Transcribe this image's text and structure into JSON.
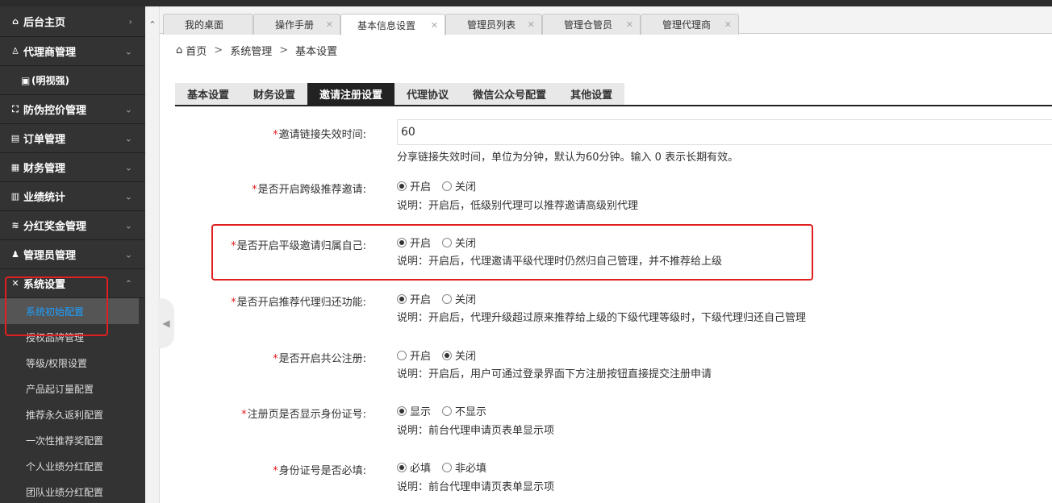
{
  "sidebar": {
    "home": {
      "label": "后台主页",
      "icon": "home-icon"
    },
    "agent_mgmt": {
      "label": "代理商管理",
      "icon": "user-icon"
    },
    "agent_sub": {
      "label": "(明视强)",
      "icon": "id-card-icon"
    },
    "anti_fake": {
      "label": "防伪控价管理",
      "icon": "scan-icon"
    },
    "orders": {
      "label": "订单管理",
      "icon": "document-icon"
    },
    "finance": {
      "label": "财务管理",
      "icon": "ledger-icon"
    },
    "stats": {
      "label": "业绩统计",
      "icon": "bar-chart-icon"
    },
    "bonus": {
      "label": "分红奖金管理",
      "icon": "database-icon"
    },
    "admins": {
      "label": "管理员管理",
      "icon": "user-gear-icon"
    },
    "system": {
      "label": "系统设置",
      "icon": "tools-icon"
    },
    "system_items": [
      {
        "label": "系统初始配置"
      },
      {
        "label": "授权品牌管理"
      },
      {
        "label": "等级/权限设置"
      },
      {
        "label": "产品起订量配置"
      },
      {
        "label": "推荐永久返利配置"
      },
      {
        "label": "一次性推荐奖配置"
      },
      {
        "label": "个人业绩分红配置"
      },
      {
        "label": "团队业绩分红配置"
      }
    ]
  },
  "tabs": [
    {
      "label": "我的桌面"
    },
    {
      "label": "操作手册"
    },
    {
      "label": "基本信息设置"
    },
    {
      "label": "管理员列表"
    },
    {
      "label": "管理仓管员"
    },
    {
      "label": "管理代理商"
    }
  ],
  "breadcrumb": {
    "home": "首页",
    "sep": ">",
    "level1": "系统管理",
    "level2": "基本设置"
  },
  "settings_tabs": [
    {
      "label": "基本设置"
    },
    {
      "label": "财务设置"
    },
    {
      "label": "邀请注册设置"
    },
    {
      "label": "代理协议"
    },
    {
      "label": "微信公众号配置"
    },
    {
      "label": "其他设置"
    }
  ],
  "form": {
    "req_mark": "*",
    "invite_expire": {
      "label": "邀请链接失效时间:",
      "value": "60",
      "hint": "分享链接失效时间，单位为分钟，默认为60分钟。输入 0 表示长期有效。"
    },
    "cross_level": {
      "label": "是否开启跨级推荐邀请:",
      "opt1": "开启",
      "opt2": "关闭",
      "selected": "开启",
      "hint": "说明：开启后，低级别代理可以推荐邀请高级别代理"
    },
    "same_level": {
      "label": "是否开启平级邀请归属自己:",
      "opt1": "开启",
      "opt2": "关闭",
      "selected": "开启",
      "hint": "说明：开启后，代理邀请平级代理时仍然归自己管理，并不推荐给上级"
    },
    "return_agent": {
      "label": "是否开启推荐代理归还功能:",
      "opt1": "开启",
      "opt2": "关闭",
      "selected": "开启",
      "hint": "说明：开启后，代理升级超过原来推荐给上级的下级代理等级时，下级代理归还自己管理"
    },
    "public_reg": {
      "label": "是否开启共公注册:",
      "opt1": "开启",
      "opt2": "关闭",
      "selected": "关闭",
      "hint": "说明：开启后，用户可通过登录界面下方注册按钮直接提交注册申请"
    },
    "show_id": {
      "label": "注册页是否显示身份证号:",
      "opt1": "显示",
      "opt2": "不显示",
      "selected": "显示",
      "hint": "说明：前台代理申请页表单显示项"
    },
    "id_required": {
      "label": "身份证号是否必填:",
      "opt1": "必填",
      "opt2": "非必填",
      "selected": "必填",
      "hint": "说明：前台代理申请页表单显示项"
    }
  },
  "colors": {
    "sidebar_bg": "#333333",
    "active_link": "#1e9fff",
    "highlight": "#e02020",
    "tab_active": "#222222"
  }
}
